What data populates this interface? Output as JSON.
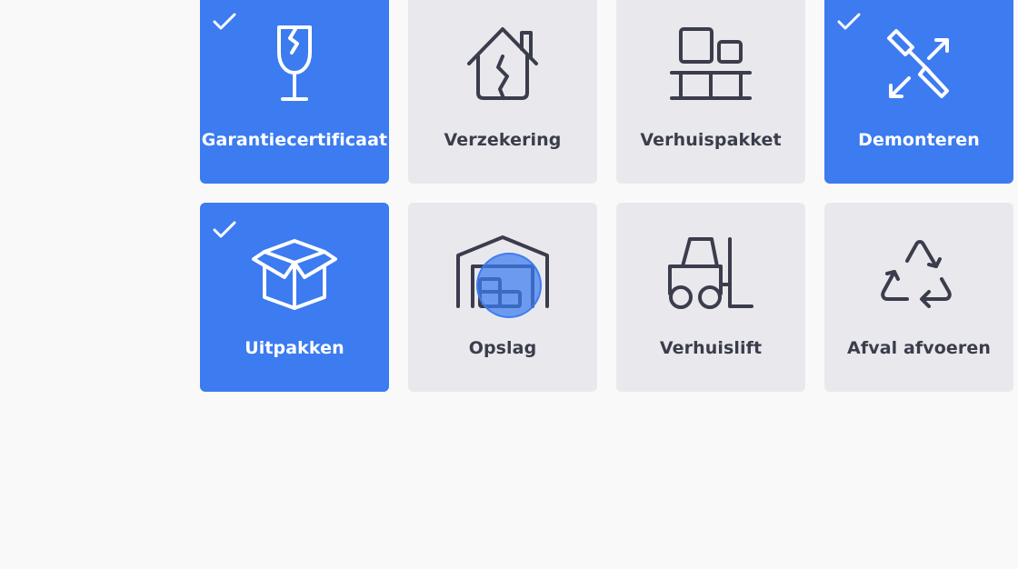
{
  "options": [
    {
      "label": "Garantiecertificaat",
      "icon": "fragile-glass-icon",
      "selected": true
    },
    {
      "label": "Verzekering",
      "icon": "cracked-house-icon",
      "selected": false
    },
    {
      "label": "Verhuispakket",
      "icon": "boxes-on-pallet-icon",
      "selected": false
    },
    {
      "label": "Demonteren",
      "icon": "screwdriver-arrows-icon",
      "selected": true
    },
    {
      "label": "Uitpakken",
      "icon": "open-box-icon",
      "selected": true
    },
    {
      "label": "Opslag",
      "icon": "storage-warehouse-icon",
      "selected": false
    },
    {
      "label": "Verhuislift",
      "icon": "forklift-icon",
      "selected": false
    },
    {
      "label": "Afval afvoeren",
      "icon": "recycle-icon",
      "selected": false
    }
  ],
  "colors": {
    "selected": "#3c7bf0",
    "unselected": "#e9e9ed",
    "text_dark": "#3b3d4c",
    "background": "#f9f9fa"
  }
}
